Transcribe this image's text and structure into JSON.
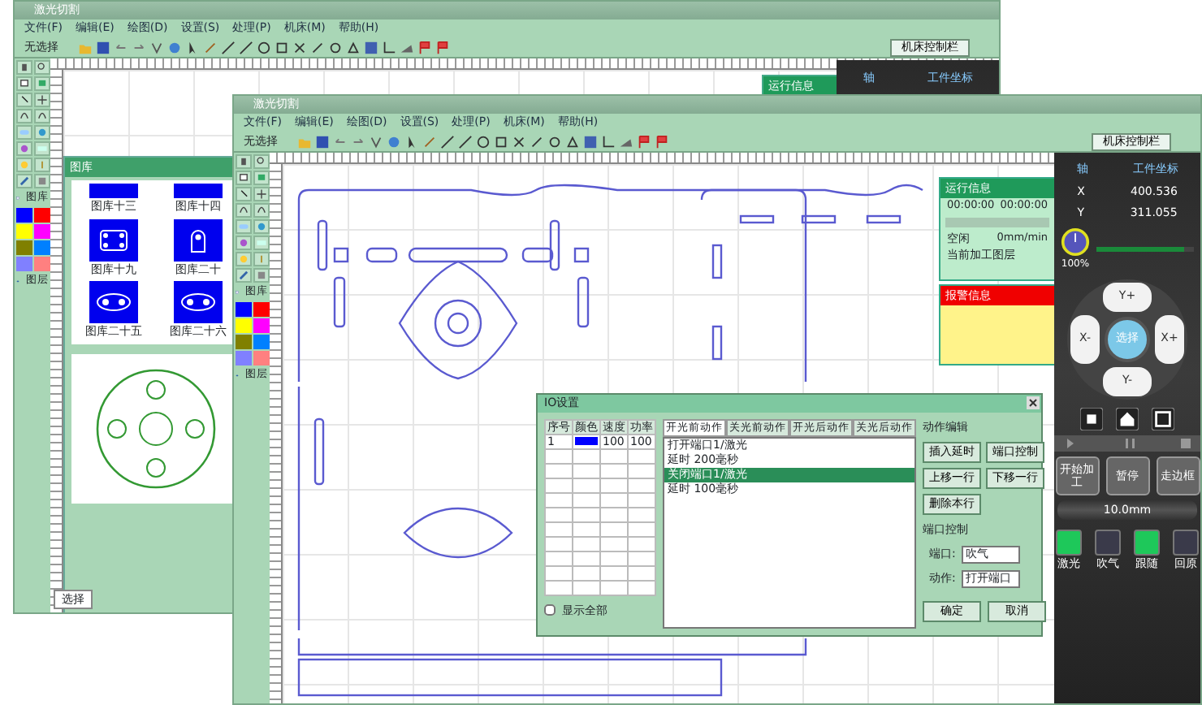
{
  "back_window": {
    "title": "激光切割",
    "menu": [
      "文件(F)",
      "编辑(E)",
      "绘图(D)",
      "设置(S)",
      "处理(P)",
      "机床(M)",
      "帮助(H)"
    ],
    "toolbar_label": "无选择",
    "control_button": "机床控制栏",
    "run_panel_title": "运行信息",
    "axis_header": [
      "轴",
      "工件坐标"
    ],
    "palette_labels": [
      "图库",
      "图层"
    ],
    "colors": [
      {
        "color": "#0000ff"
      },
      {
        "color": "#ff0000"
      },
      {
        "color": "#ffff00"
      },
      {
        "color": "#ff00ff"
      },
      {
        "color": "#808000"
      },
      {
        "color": "#0080ff"
      },
      {
        "color": "#8080ff"
      },
      {
        "color": "#ff8080"
      }
    ],
    "gallery": {
      "title": "图库",
      "items": [
        {
          "label": "图库十三",
          "kind": "cut"
        },
        {
          "label": "图库十四",
          "kind": "cut"
        },
        {
          "label": "图库十九",
          "kind": "four"
        },
        {
          "label": "图库二十",
          "kind": "slot"
        },
        {
          "label": "图库二十五",
          "kind": "pair"
        },
        {
          "label": "图库二十六",
          "kind": "pair"
        }
      ]
    },
    "status": "选择"
  },
  "front_window": {
    "title": "激光切割",
    "menu": [
      "文件(F)",
      "编辑(E)",
      "绘图(D)",
      "设置(S)",
      "处理(P)",
      "机床(M)",
      "帮助(H)"
    ],
    "toolbar_label": "无选择",
    "control_button": "机床控制栏",
    "palette_labels": [
      "图库",
      "图层"
    ],
    "colors": [
      {
        "color": "#0000ff"
      },
      {
        "color": "#ff0000"
      },
      {
        "color": "#ffff00"
      },
      {
        "color": "#ff00ff"
      },
      {
        "color": "#808000"
      },
      {
        "color": "#0080ff"
      },
      {
        "color": "#8080ff"
      },
      {
        "color": "#ff8080"
      }
    ],
    "run_info": {
      "title": "运行信息",
      "time_left": "00:00:00",
      "time_right": "00:00:00",
      "state": "空闲",
      "speed": "0mm/min",
      "current": "当前加工图层"
    },
    "alarm": {
      "title": "报警信息"
    },
    "dialog": {
      "title": "IO设置",
      "columns": [
        "序号",
        "颜色",
        "速度",
        "功率"
      ],
      "rows": [
        {
          "cells": [
            "1",
            "",
            "100",
            "100"
          ],
          "color": "#0000ff"
        }
      ],
      "tabs": [
        {
          "label": "开光前动作",
          "selected": true
        },
        {
          "label": "关光前动作",
          "selected": false
        },
        {
          "label": "开光后动作",
          "selected": false
        },
        {
          "label": "关光后动作",
          "selected": false
        }
      ],
      "actions": [
        {
          "label": "打开端口1/激光",
          "selected": false
        },
        {
          "label": "延时 200毫秒",
          "selected": false
        },
        {
          "label": "关闭端口1/激光",
          "selected": true
        },
        {
          "label": "延时 100毫秒",
          "selected": false
        }
      ],
      "edit_group": "动作编辑",
      "edit_buttons": [
        "插入延时",
        "端口控制",
        "上移一行",
        "下移一行",
        "删除本行"
      ],
      "port_group": "端口控制",
      "port_label": "端口:",
      "port_value": "吹气",
      "action_label": "动作:",
      "action_value": "打开端口",
      "show_all": {
        "label": "显示全部",
        "checked": false
      },
      "ok": "确定",
      "cancel": "取消"
    },
    "machine": {
      "axis_header": [
        "轴",
        "工件坐标"
      ],
      "axes": [
        {
          "name": "X",
          "value": "400.536"
        },
        {
          "name": "Y",
          "value": "311.055"
        }
      ],
      "speed": "100%",
      "level": 0.9,
      "jog": {
        "up": "Y+",
        "left": "X-",
        "center": "选择",
        "right": "X+",
        "down": "Y-"
      },
      "run_buttons": [
        "开始加工",
        "暂停",
        "走边框"
      ],
      "step": "10.0mm",
      "functions": [
        {
          "label": "激光",
          "on": true
        },
        {
          "label": "吹气",
          "on": false
        },
        {
          "label": "跟随",
          "on": true
        },
        {
          "label": "回原",
          "on": false
        }
      ]
    }
  }
}
